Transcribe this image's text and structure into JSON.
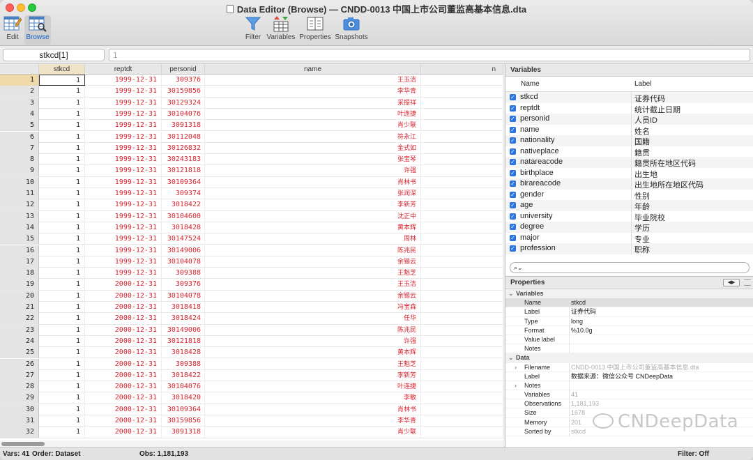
{
  "window": {
    "title": "Data Editor (Browse) — CNDD-0013 中国上市公司董监高基本信息.dta"
  },
  "toolbar": {
    "edit": "Edit",
    "browse": "Browse",
    "filter": "Filter",
    "variables": "Variables",
    "properties": "Properties",
    "snapshots": "Snapshots"
  },
  "editbar": {
    "cell_ref": "stkcd[1]",
    "cell_value": "1"
  },
  "grid": {
    "columns": [
      "stkcd",
      "reptdt",
      "personid",
      "name",
      "n"
    ],
    "rows": [
      [
        "1",
        "1",
        "1999-12-31",
        "309376",
        "王玉洁"
      ],
      [
        "2",
        "1",
        "1999-12-31",
        "30159856",
        "李华青"
      ],
      [
        "3",
        "1",
        "1999-12-31",
        "30129324",
        "采振祥"
      ],
      [
        "4",
        "1",
        "1999-12-31",
        "30104076",
        "叶连捷"
      ],
      [
        "5",
        "1",
        "1999-12-31",
        "3091318",
        "肖少联"
      ],
      [
        "6",
        "1",
        "1999-12-31",
        "30112048",
        "符永江"
      ],
      [
        "7",
        "1",
        "1999-12-31",
        "30126832",
        "金式如"
      ],
      [
        "8",
        "1",
        "1999-12-31",
        "30243183",
        "张宝琴"
      ],
      [
        "9",
        "1",
        "1999-12-31",
        "30121818",
        "许强"
      ],
      [
        "10",
        "1",
        "1999-12-31",
        "30109364",
        "肖林书"
      ],
      [
        "11",
        "1",
        "1999-12-31",
        "309374",
        "张润深"
      ],
      [
        "12",
        "1",
        "1999-12-31",
        "3018422",
        "李新芳"
      ],
      [
        "13",
        "1",
        "1999-12-31",
        "30104600",
        "沈正中"
      ],
      [
        "14",
        "1",
        "1999-12-31",
        "3018428",
        "黄本辉"
      ],
      [
        "15",
        "1",
        "1999-12-31",
        "30147524",
        "周林"
      ],
      [
        "16",
        "1",
        "1999-12-31",
        "30149006",
        "陈兆民"
      ],
      [
        "17",
        "1",
        "1999-12-31",
        "30104078",
        "余锡云"
      ],
      [
        "18",
        "1",
        "1999-12-31",
        "309388",
        "王魁芝"
      ],
      [
        "19",
        "1",
        "2000-12-31",
        "309376",
        "王玉洁"
      ],
      [
        "20",
        "1",
        "2000-12-31",
        "30104078",
        "余锡云"
      ],
      [
        "21",
        "1",
        "2000-12-31",
        "3018418",
        "冯宝森"
      ],
      [
        "22",
        "1",
        "2000-12-31",
        "3018424",
        "任华"
      ],
      [
        "23",
        "1",
        "2000-12-31",
        "30149006",
        "陈兆民"
      ],
      [
        "24",
        "1",
        "2000-12-31",
        "30121818",
        "许强"
      ],
      [
        "25",
        "1",
        "2000-12-31",
        "3018428",
        "黄本辉"
      ],
      [
        "26",
        "1",
        "2000-12-31",
        "309388",
        "王魁芝"
      ],
      [
        "27",
        "1",
        "2000-12-31",
        "3018422",
        "李新芳"
      ],
      [
        "28",
        "1",
        "2000-12-31",
        "30104076",
        "叶连捷"
      ],
      [
        "29",
        "1",
        "2000-12-31",
        "3018420",
        "李敏"
      ],
      [
        "30",
        "1",
        "2000-12-31",
        "30109364",
        "肖林书"
      ],
      [
        "31",
        "1",
        "2000-12-31",
        "30159856",
        "李华青"
      ],
      [
        "32",
        "1",
        "2000-12-31",
        "3091318",
        "肖少联"
      ]
    ]
  },
  "variables_panel": {
    "title": "Variables",
    "col_name": "Name",
    "col_label": "Label",
    "items": [
      [
        "stkcd",
        "证券代码"
      ],
      [
        "reptdt",
        "统计截止日期"
      ],
      [
        "personid",
        "人员ID"
      ],
      [
        "name",
        "姓名"
      ],
      [
        "nationality",
        "国籍"
      ],
      [
        "nativeplace",
        "籍贯"
      ],
      [
        "natareacode",
        "籍贯所在地区代码"
      ],
      [
        "birthplace",
        "出生地"
      ],
      [
        "birareacode",
        "出生地所在地区代码"
      ],
      [
        "gender",
        "性别"
      ],
      [
        "age",
        "年龄"
      ],
      [
        "university",
        "毕业院校"
      ],
      [
        "degree",
        "学历"
      ],
      [
        "major",
        "专业"
      ],
      [
        "profession",
        "职称"
      ]
    ]
  },
  "properties_panel": {
    "title": "Properties",
    "sec_variables": "Variables",
    "sec_data": "Data",
    "var_props": [
      [
        "Name",
        "stkcd"
      ],
      [
        "Label",
        "证券代码"
      ],
      [
        "Type",
        "long"
      ],
      [
        "Format",
        "%10.0g"
      ],
      [
        "Value label",
        ""
      ],
      [
        "Notes",
        ""
      ]
    ],
    "data_props": [
      [
        "Filename",
        "CNDD-0013 中国上市公司董监高基本信息.dta"
      ],
      [
        "Label",
        "数据来源：微信公众号 CNDeepData"
      ],
      [
        "Notes",
        ""
      ],
      [
        "Variables",
        "41"
      ],
      [
        "Observations",
        "1,181,193"
      ],
      [
        "Size",
        "1678"
      ],
      [
        "Memory",
        "201"
      ],
      [
        "Sorted by",
        "stkcd"
      ]
    ]
  },
  "watermark": "CNDeepData",
  "status": {
    "vars": "Vars: 41",
    "order": "Order: Dataset",
    "obs": "Obs: 1,181,193",
    "filter": "Filter: Off"
  }
}
